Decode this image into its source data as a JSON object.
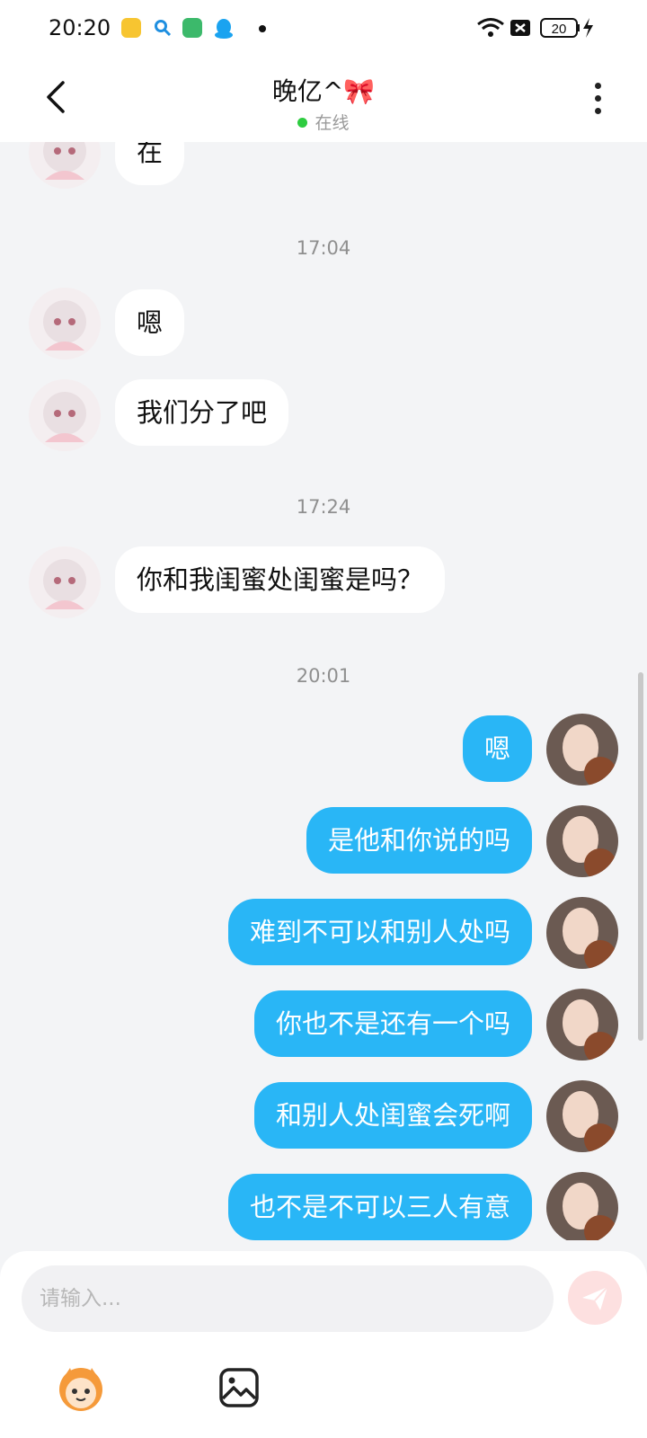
{
  "status_bar": {
    "time": "20:20",
    "battery": "20"
  },
  "header": {
    "title": "晚亿^🎀",
    "status": "在线"
  },
  "messages": [
    {
      "side": "in",
      "text": "在"
    },
    {
      "time": "17:04"
    },
    {
      "side": "in",
      "text": "嗯"
    },
    {
      "side": "in",
      "text": "我们分了吧"
    },
    {
      "time": "17:24"
    },
    {
      "side": "in",
      "text": "你和我闺蜜处闺蜜是吗？"
    },
    {
      "time": "20:01"
    },
    {
      "side": "out",
      "text": "嗯"
    },
    {
      "side": "out",
      "text": "是他和你说的吗"
    },
    {
      "side": "out",
      "text": "难到不可以和别人处吗"
    },
    {
      "side": "out",
      "text": "你也不是还有一个吗"
    },
    {
      "side": "out",
      "text": "和别人处闺蜜会死啊"
    },
    {
      "side": "out",
      "text": "也不是不可以三人有意"
    }
  ],
  "composer": {
    "placeholder": "请输入..."
  },
  "colors": {
    "outgoing_bubble": "#29b6f6",
    "incoming_bubble": "#ffffff",
    "online_dot": "#2ecc40"
  },
  "icons": [
    "back-icon",
    "more-icon",
    "send-icon",
    "mascot-emoji-icon",
    "image-icon"
  ]
}
